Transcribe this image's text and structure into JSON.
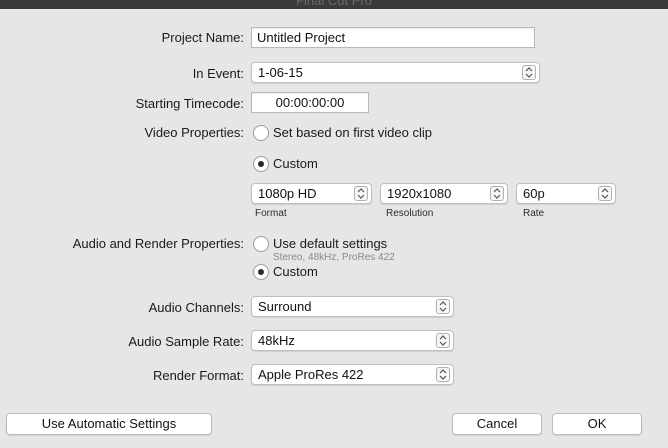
{
  "window": {
    "title": "Final Cut Pro"
  },
  "form": {
    "project_name": {
      "label": "Project Name:",
      "value": "Untitled Project"
    },
    "in_event": {
      "label": "In Event:",
      "value": "1-06-15"
    },
    "starting_timecode": {
      "label": "Starting Timecode:",
      "value": "00:00:00:00"
    },
    "video_properties": {
      "label": "Video Properties:",
      "option_first_clip": "Set based on first video clip",
      "option_custom": "Custom",
      "selected": "custom",
      "format": {
        "value": "1080p HD",
        "caption": "Format"
      },
      "resolution": {
        "value": "1920x1080",
        "caption": "Resolution"
      },
      "rate": {
        "value": "60p",
        "caption": "Rate"
      }
    },
    "audio_render": {
      "label": "Audio and Render Properties:",
      "option_default": "Use default settings",
      "default_detail": "Stereo, 48kHz, ProRes 422",
      "option_custom": "Custom",
      "selected": "custom"
    },
    "audio_channels": {
      "label": "Audio Channels:",
      "value": "Surround"
    },
    "audio_sample_rate": {
      "label": "Audio Sample Rate:",
      "value": "48kHz"
    },
    "render_format": {
      "label": "Render Format:",
      "value": "Apple ProRes 422"
    }
  },
  "buttons": {
    "use_automatic": "Use Automatic Settings",
    "cancel": "Cancel",
    "ok": "OK"
  }
}
